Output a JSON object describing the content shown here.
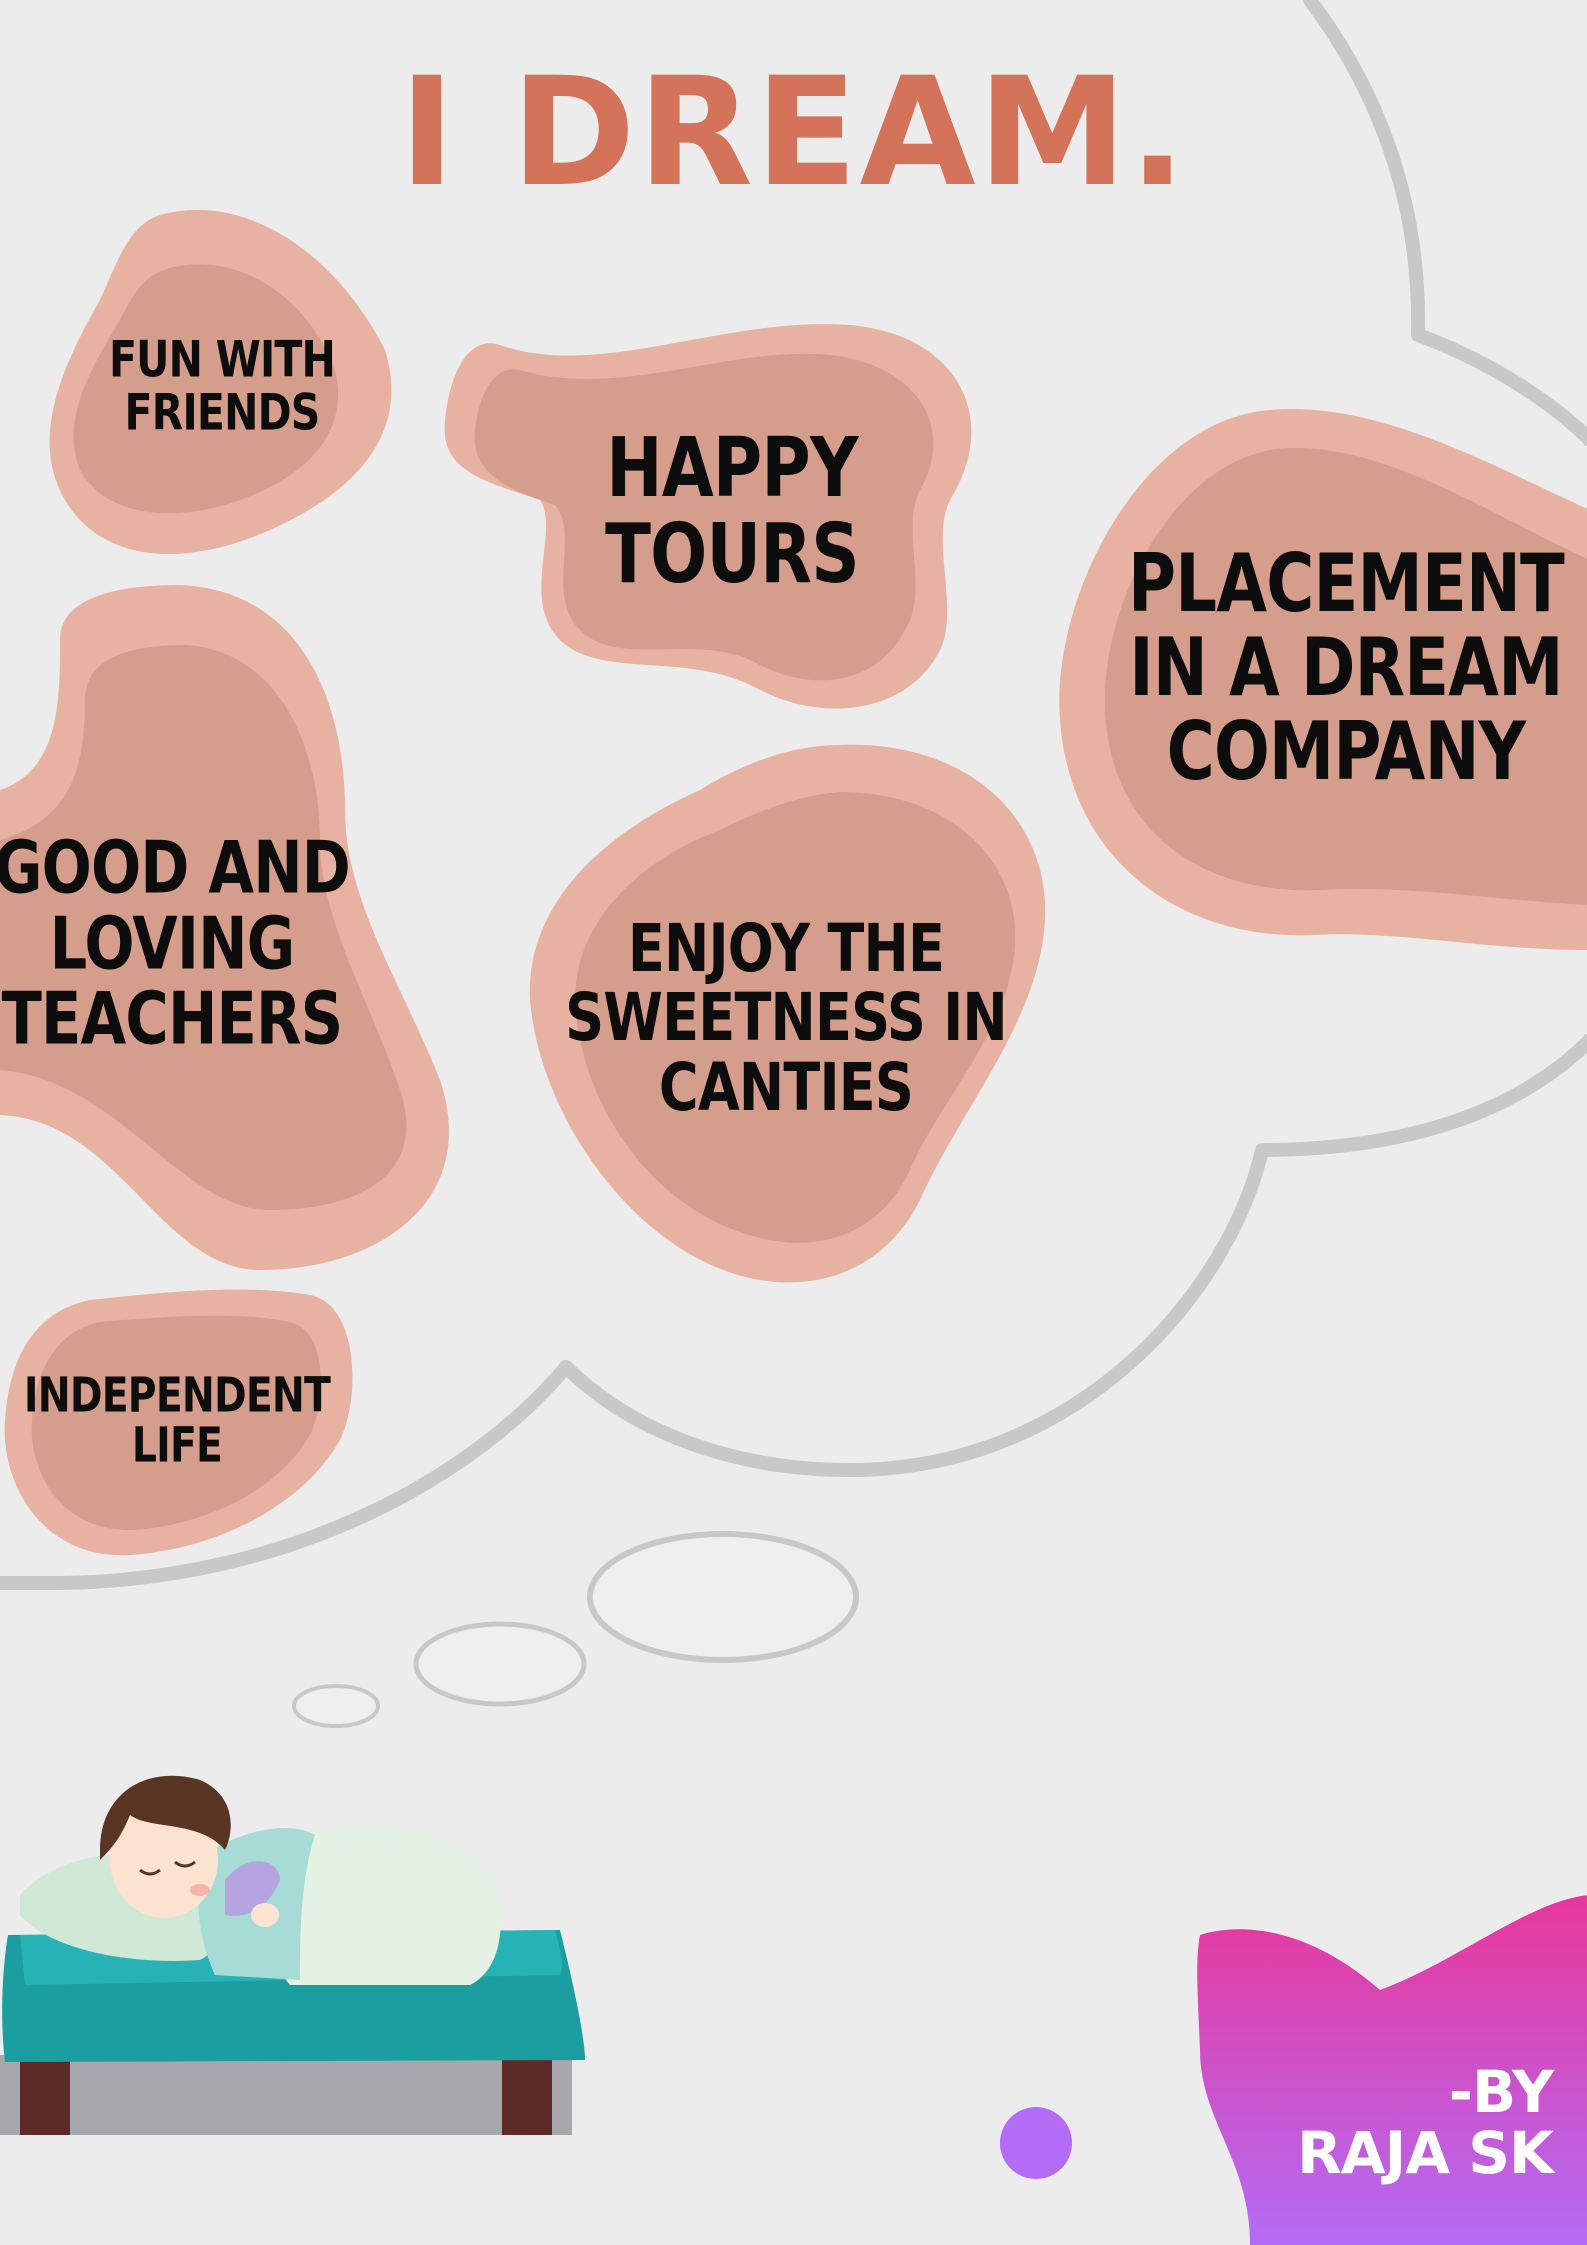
{
  "poster": {
    "title": "I DREAM.",
    "dreams": [
      {
        "id": "fun-with-friends",
        "label": "FUN WITH\nFRIENDS"
      },
      {
        "id": "happy-tours",
        "label": "HAPPY\n  TOURS"
      },
      {
        "id": "placement",
        "label": "PLACEMENT\nIN A DREAM\nCOMPANY"
      },
      {
        "id": "good-teachers",
        "label": "GOOD AND\nLOVING\nTEACHERS"
      },
      {
        "id": "enjoy-sweetness",
        "label": "ENJOY THE\nSWEETNESS IN\nCANTIES"
      },
      {
        "id": "independent-life",
        "label": "INDEPENDENT\nLIFE"
      }
    ],
    "credit": "-BY\nRAJA SK"
  },
  "colors": {
    "background": "#ececec",
    "title": "#d4735a",
    "blob_outer": "#e8b2a3",
    "blob_inner": "#d59d8c",
    "cloud_outline": "#c8c8c8",
    "corner_gradient_top": "#e8379a",
    "corner_gradient_bottom": "#b36cf5",
    "dot": "#b36cf5"
  },
  "icons": {
    "illustration": "sleeping-boy-in-bed",
    "bubble": "thought-cloud"
  }
}
